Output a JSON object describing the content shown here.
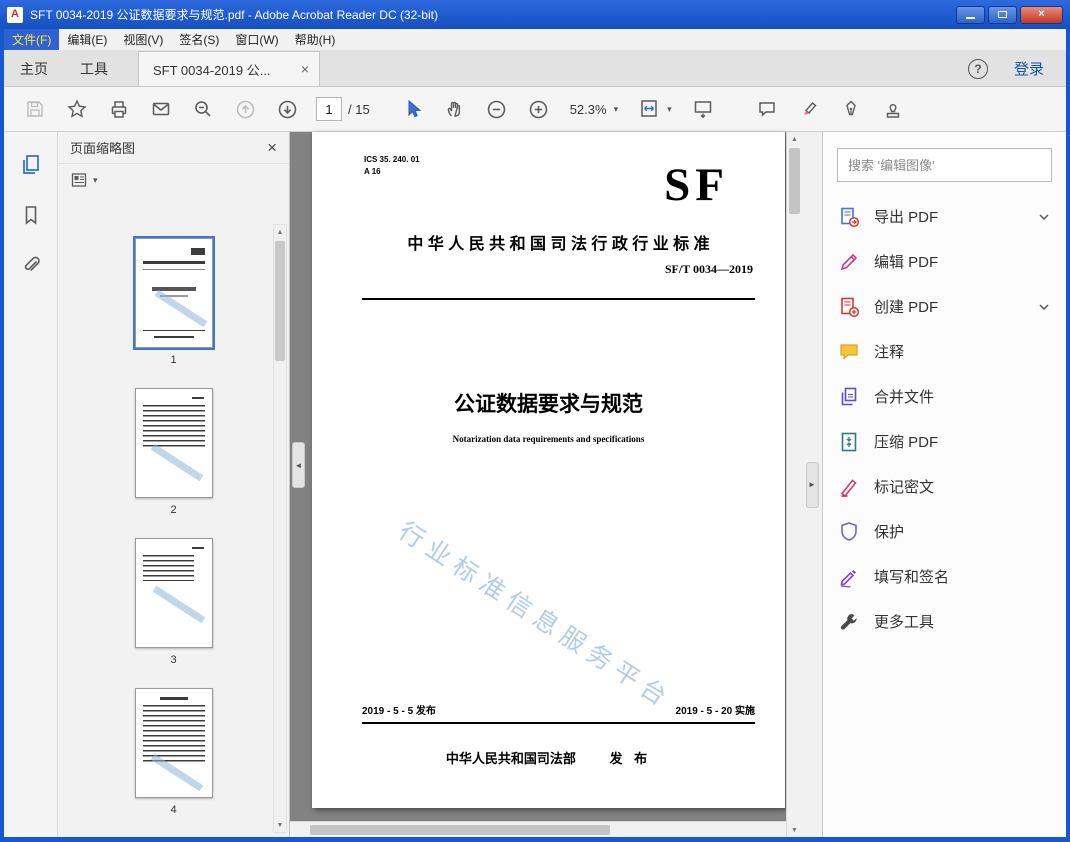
{
  "window_title": "SFT 0034-2019 公证数据要求与规范.pdf - Adobe Acrobat Reader DC (32-bit)",
  "menu": {
    "items": [
      "文件(F)",
      "编辑(E)",
      "视图(V)",
      "签名(S)",
      "窗口(W)",
      "帮助(H)"
    ]
  },
  "tabs": {
    "home": "主页",
    "tools": "工具",
    "document": "SFT 0034-2019 公...",
    "sign_in": "登录"
  },
  "toolbar": {
    "page_current": "1",
    "page_total": "/ 15",
    "zoom_level": "52.3%"
  },
  "left_panel": {
    "title": "页面缩略图",
    "page_numbers": [
      "1",
      "2",
      "3",
      "4"
    ]
  },
  "document": {
    "ics_line1": "ICS 35. 240. 01",
    "ics_line2": "A 16",
    "logo": "SF",
    "standard_caption": "中 华 人 民 共 和 国 司 法 行 政 行 业 标 准",
    "standard_number": "SF/T 0034—2019",
    "title": "公证数据要求与规范",
    "subtitle": "Notarization data requirements and specifications",
    "watermark": "行业标准信息服务平台",
    "issue_date": "2019 - 5 - 5 发布",
    "implement_date": "2019 - 5 - 20 实施",
    "publisher": "中华人民共和国司法部",
    "publish_label": "发 布"
  },
  "right_panel": {
    "search_placeholder": "搜索 '编辑图像'",
    "tools": [
      {
        "label": "导出 PDF"
      },
      {
        "label": "编辑 PDF"
      },
      {
        "label": "创建 PDF"
      },
      {
        "label": "注释"
      },
      {
        "label": "合并文件"
      },
      {
        "label": "压缩 PDF"
      },
      {
        "label": "标记密文"
      },
      {
        "label": "保护"
      },
      {
        "label": "填写和签名"
      },
      {
        "label": "更多工具"
      }
    ]
  },
  "icons": {
    "close": "×",
    "chevron_down": "▾",
    "help": "?",
    "up_arrow": "▲",
    "down_arrow": "▼",
    "left_arrow": "◄",
    "right_arrow": "►",
    "logo_letter": "A"
  },
  "colors": {
    "accent_blue": "#2a6fd0",
    "menu_highlight": "#2e63cf",
    "doc_bg": "#828282"
  }
}
